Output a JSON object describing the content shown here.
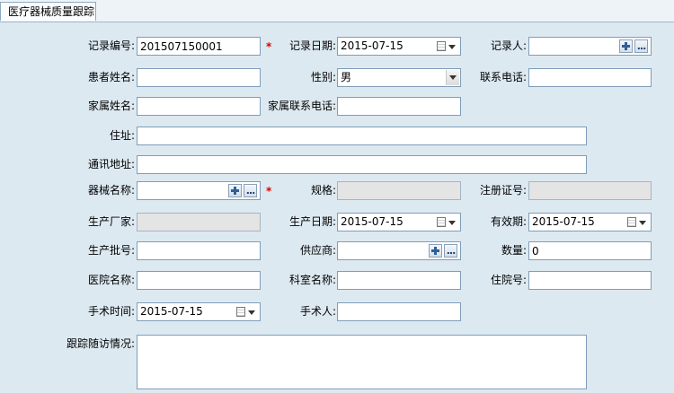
{
  "tab": {
    "label": "医疗器械质量跟踪"
  },
  "required_mark": "*",
  "fields": {
    "record_no": {
      "label": "记录编号:",
      "value": "201507150001"
    },
    "record_date": {
      "label": "记录日期:",
      "value": "2015-07-15"
    },
    "recorder": {
      "label": "记录人:",
      "value": ""
    },
    "patient_name": {
      "label": "患者姓名:",
      "value": ""
    },
    "gender": {
      "label": "性别:",
      "value": "男"
    },
    "phone": {
      "label": "联系电话:",
      "value": ""
    },
    "family_name": {
      "label": "家属姓名:",
      "value": ""
    },
    "family_phone": {
      "label": "家属联系电话:",
      "value": ""
    },
    "address": {
      "label": "住址:",
      "value": ""
    },
    "mail_address": {
      "label": "通讯地址:",
      "value": ""
    },
    "device_name": {
      "label": "器械名称:",
      "value": ""
    },
    "spec": {
      "label": "规格:",
      "value": ""
    },
    "reg_no": {
      "label": "注册证号:",
      "value": ""
    },
    "manufacturer": {
      "label": "生产厂家:",
      "value": ""
    },
    "prod_date": {
      "label": "生产日期:",
      "value": "2015-07-15"
    },
    "expiry": {
      "label": "有效期:",
      "value": "2015-07-15"
    },
    "batch_no": {
      "label": "生产批号:",
      "value": ""
    },
    "supplier": {
      "label": "供应商:",
      "value": ""
    },
    "quantity": {
      "label": "数量:",
      "value": "0"
    },
    "hospital": {
      "label": "医院名称:",
      "value": ""
    },
    "department": {
      "label": "科室名称:",
      "value": ""
    },
    "inpatient_no": {
      "label": "住院号:",
      "value": ""
    },
    "surgery_time": {
      "label": "手术时间:",
      "value": "2015-07-15"
    },
    "surgeon": {
      "label": "手术人:",
      "value": ""
    },
    "followup": {
      "label": "跟踪随访情况:",
      "value": ""
    }
  }
}
